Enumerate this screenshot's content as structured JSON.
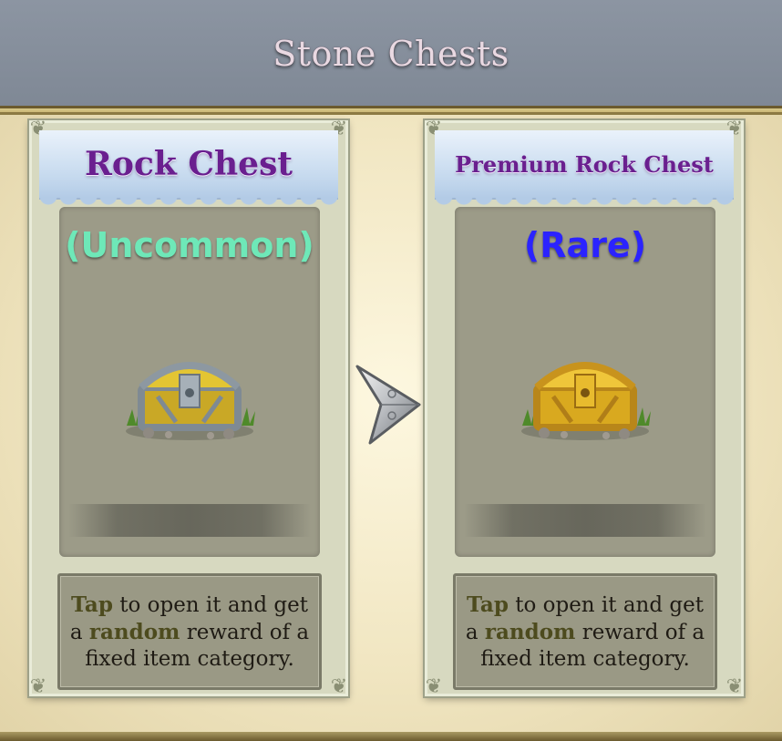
{
  "header": {
    "title": "Stone Chests"
  },
  "cards": [
    {
      "name": "Rock Chest",
      "rarity": "(Uncommon)",
      "rarity_color": "#6ee8b8",
      "chest_icon": "stone-chest-icon",
      "info": {
        "tap": "Tap",
        "part1": " to open it and get a ",
        "random": "random",
        "part2": " reward of a fixed item category."
      }
    },
    {
      "name": "Premium Rock Chest",
      "rarity": "(Rare)",
      "rarity_color": "#2b23ff",
      "chest_icon": "golden-chest-icon",
      "info": {
        "tap": "Tap",
        "part1": " to open it and get a ",
        "random": "random",
        "part2": " reward of a fixed item category."
      }
    }
  ],
  "upgrade_arrow_icon": "upgrade-arrow-icon",
  "colors": {
    "header_bg": "#8c95a2",
    "banner_text": "#6a1f8f",
    "parchment": "#ece0b8"
  }
}
